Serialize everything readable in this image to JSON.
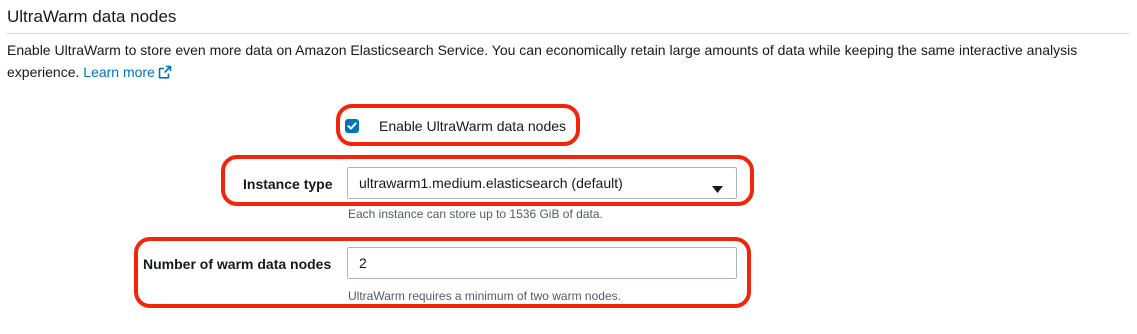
{
  "section": {
    "title": "UltraWarm data nodes",
    "description": "Enable UltraWarm to store even more data on Amazon Elasticsearch Service. You can economically retain large amounts of data while keeping the same interactive analysis experience.",
    "learn_more": "Learn more",
    "learn_more_icon": "external-link-icon"
  },
  "ultrawarm": {
    "enable_label": "Enable UltraWarm data nodes",
    "enabled": true,
    "instance_type": {
      "label": "Instance type",
      "value": "ultrawarm1.medium.elasticsearch (default)",
      "hint": "Each instance can store up to 1536 GiB of data."
    },
    "warm_nodes": {
      "label": "Number of warm data nodes",
      "value": "2",
      "hint": "UltraWarm requires a minimum of two warm nodes."
    }
  },
  "colors": {
    "accent": "#0073bb",
    "highlight": "#f2240a"
  }
}
